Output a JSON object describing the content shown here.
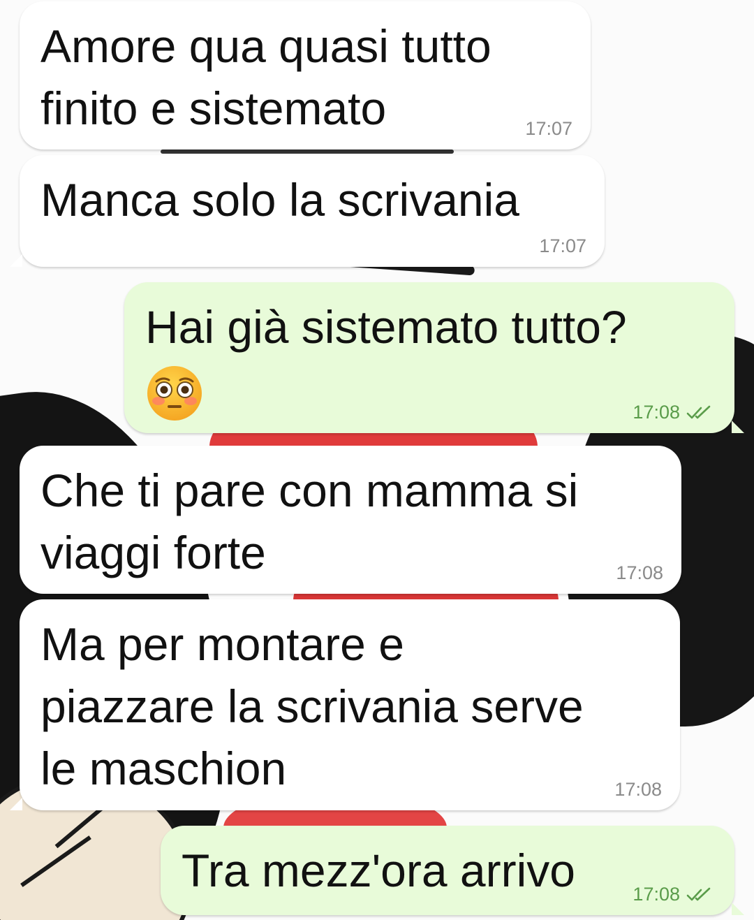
{
  "messages": [
    {
      "direction": "in",
      "text": "Amore qua quasi tutto\nfinito e sistemato",
      "time": "17:07"
    },
    {
      "direction": "in",
      "text": "Manca solo la scrivania",
      "time": "17:07"
    },
    {
      "direction": "out",
      "text": "Hai già sistemato tutto?",
      "emoji": "flushed-face-emoji",
      "time": "17:08",
      "status": "read"
    },
    {
      "direction": "in",
      "text": "Che ti pare con mamma si\nviaggi forte",
      "time": "17:08"
    },
    {
      "direction": "in",
      "text": "Ma per montare e\npiazzare la scrivania serve\nle maschion",
      "time": "17:08"
    },
    {
      "direction": "out",
      "text": "Tra mezz'ora arrivo",
      "time": "17:08",
      "status": "read"
    }
  ],
  "colors": {
    "incoming_bubble": "#ffffff",
    "outgoing_bubble": "#e8fbd9",
    "read_ticks": "#5a9c4a",
    "timestamp_in": "#8a8a8a",
    "timestamp_out": "#5a9c4a"
  }
}
